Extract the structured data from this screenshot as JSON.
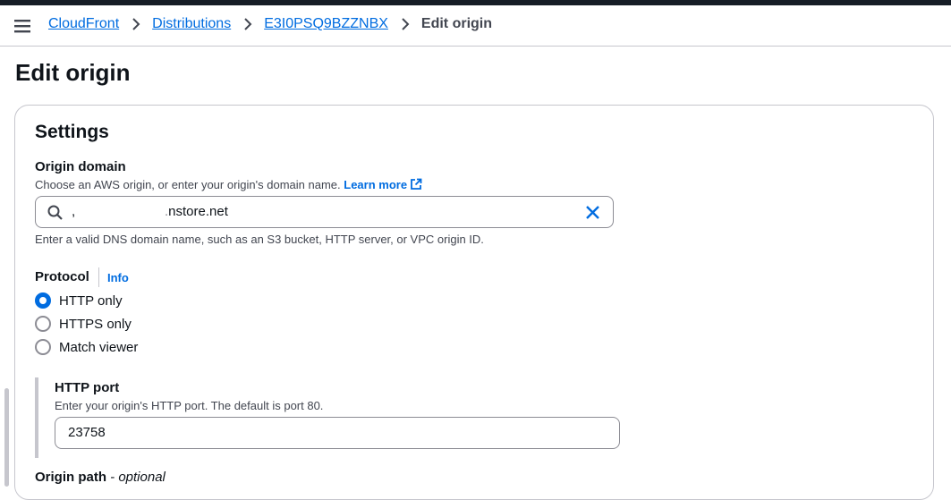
{
  "breadcrumb": {
    "items": [
      "CloudFront",
      "Distributions",
      "E3I0PSQ9BZZNBX"
    ],
    "current": "Edit origin"
  },
  "page": {
    "title": "Edit origin"
  },
  "settings": {
    "title": "Settings",
    "origin_domain": {
      "label": "Origin domain",
      "description": "Choose an AWS origin, or enter your origin's domain name.",
      "learn_more": "Learn more",
      "value": "nstore.net",
      "hint": "Enter a valid DNS domain name, such as an S3 bucket, HTTP server, or VPC origin ID."
    },
    "protocol": {
      "label": "Protocol",
      "info": "Info",
      "options": [
        "HTTP only",
        "HTTPS only",
        "Match viewer"
      ],
      "selected": "HTTP only"
    },
    "http_port": {
      "label": "HTTP port",
      "description": "Enter your origin's HTTP port. The default is port 80.",
      "value": "23758"
    },
    "origin_path": {
      "label": "Origin path",
      "optional": " - optional"
    }
  },
  "colors": {
    "accent": "#006ce0",
    "border": "#8c8c94",
    "text": "#0f141a"
  }
}
